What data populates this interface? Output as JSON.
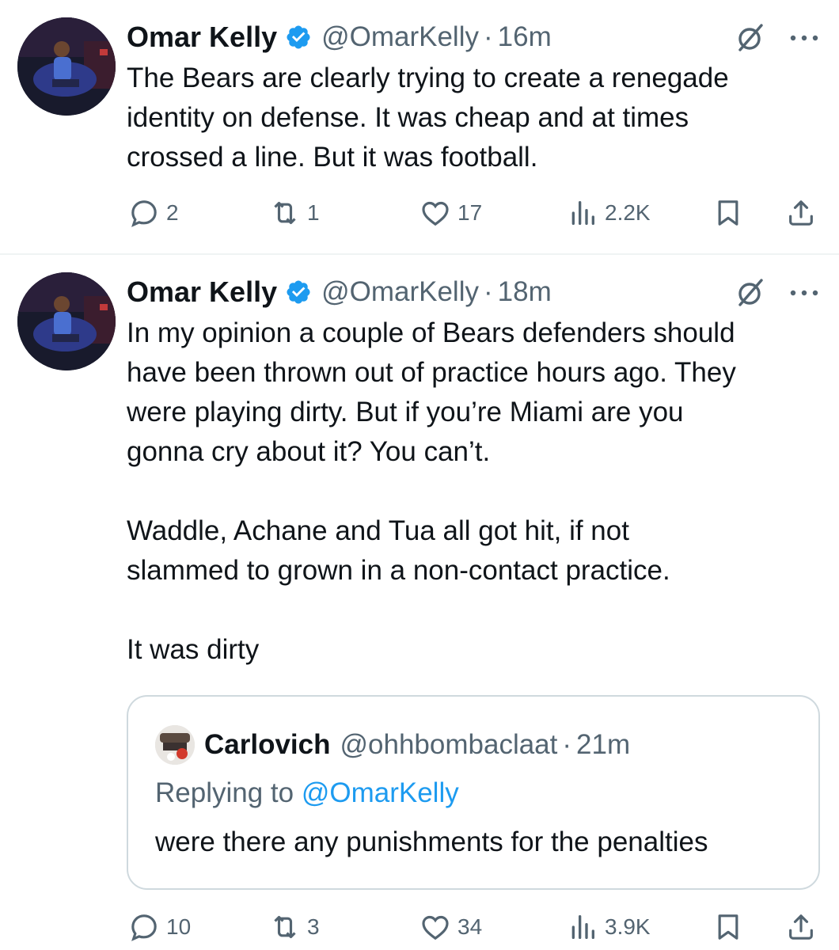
{
  "tweets": [
    {
      "author_name": "Omar Kelly",
      "handle": "@OmarKelly",
      "separator": "·",
      "time": "16m",
      "text": "The Bears are clearly trying to create a renegade\nidentity on defense. It was cheap and at times\ncrossed a line. But it was football.",
      "replies": "2",
      "reposts": "1",
      "likes": "17",
      "views": "2.2K"
    },
    {
      "author_name": "Omar Kelly",
      "handle": "@OmarKelly",
      "separator": "·",
      "time": "18m",
      "text": "In my opinion a couple of Bears defenders should\nhave been thrown out of practice hours ago. They\nwere playing dirty. But if you’re Miami are you\ngonna cry about it? You can’t.\n\nWaddle, Achane and Tua all got hit, if not\nslammed to grown in a non-contact practice.\n\nIt was dirty",
      "quoted": {
        "author_name": "Carlovich",
        "handle": "@ohhbombaclaat",
        "separator": "·",
        "time": "21m",
        "replying_prefix": "Replying to ",
        "replying_mention": "@OmarKelly",
        "text": "were there any punishments for the penalties"
      },
      "replies": "10",
      "reposts": "3",
      "likes": "34",
      "views": "3.9K"
    }
  ],
  "icons": {
    "verified": "verified-badge-icon",
    "grok": "grok-icon",
    "more": "more-icon",
    "reply": "reply-icon",
    "repost": "repost-icon",
    "like": "like-icon",
    "views": "views-icon",
    "bookmark": "bookmark-icon",
    "share": "share-icon"
  },
  "colors": {
    "text": "#0f1419",
    "secondary": "#536471",
    "link": "#1d9bf0",
    "border": "#cfd9de",
    "verified": "#1d9bf0"
  }
}
